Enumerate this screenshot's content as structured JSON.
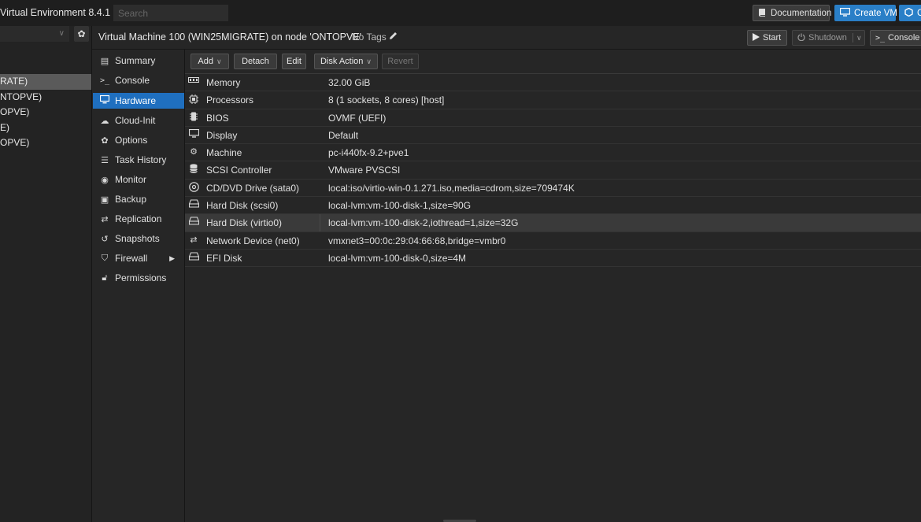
{
  "topbar": {
    "title": "Virtual Environment 8.4.1",
    "search_placeholder": "Search",
    "doc_label": "Documentation",
    "create_vm_label": "Create VM",
    "create_ct_label": "C"
  },
  "tree": {
    "items": [
      {
        "label": "RATE)",
        "selected": true
      },
      {
        "label": "NTOPVE)",
        "selected": false
      },
      {
        "label": "OPVE)",
        "selected": false
      },
      {
        "label": "E)",
        "selected": false
      },
      {
        "label": "OPVE)",
        "selected": false
      }
    ]
  },
  "header": {
    "title": "Virtual Machine 100 (WIN25MIGRATE) on node 'ONTOPVE'",
    "tags": "No Tags",
    "start_label": "Start",
    "shutdown_label": "Shutdown",
    "console_label": "Console"
  },
  "nav": {
    "items": [
      {
        "label": "Summary",
        "icon": "book-icon"
      },
      {
        "label": "Console",
        "icon": "terminal-icon"
      },
      {
        "label": "Hardware",
        "icon": "monitor-icon",
        "active": true
      },
      {
        "label": "Cloud-Init",
        "icon": "cloud-icon"
      },
      {
        "label": "Options",
        "icon": "gear-icon"
      },
      {
        "label": "Task History",
        "icon": "list-icon"
      },
      {
        "label": "Monitor",
        "icon": "eye-icon"
      },
      {
        "label": "Backup",
        "icon": "floppy-icon"
      },
      {
        "label": "Replication",
        "icon": "retweet-icon"
      },
      {
        "label": "Snapshots",
        "icon": "history-icon"
      },
      {
        "label": "Firewall",
        "icon": "shield-icon"
      },
      {
        "label": "Permissions",
        "icon": "unlock-icon"
      }
    ]
  },
  "toolbar": {
    "add_label": "Add",
    "detach_label": "Detach",
    "edit_label": "Edit",
    "disk_action_label": "Disk Action",
    "revert_label": "Revert"
  },
  "hardware": {
    "rows": [
      {
        "key": "Memory",
        "value": "32.00 GiB",
        "icon": "memory-icon"
      },
      {
        "key": "Processors",
        "value": "8 (1 sockets, 8 cores) [host]",
        "icon": "cpu-icon"
      },
      {
        "key": "BIOS",
        "value": "OVMF (UEFI)",
        "icon": "microchip-icon"
      },
      {
        "key": "Display",
        "value": "Default",
        "icon": "desktop-icon"
      },
      {
        "key": "Machine",
        "value": "pc-i440fx-9.2+pve1",
        "icon": "cogs-icon"
      },
      {
        "key": "SCSI Controller",
        "value": "VMware PVSCSI",
        "icon": "database-icon"
      },
      {
        "key": "CD/DVD Drive (sata0)",
        "value": "local:iso/virtio-win-0.1.271.iso,media=cdrom,size=709474K",
        "icon": "cdrom-icon"
      },
      {
        "key": "Hard Disk (scsi0)",
        "value": "local-lvm:vm-100-disk-1,size=90G",
        "icon": "hdd-icon"
      },
      {
        "key": "Hard Disk (virtio0)",
        "value": "local-lvm:vm-100-disk-2,iothread=1,size=32G",
        "icon": "hdd-icon",
        "selected": true
      },
      {
        "key": "Network Device (net0)",
        "value": "vmxnet3=00:0c:29:04:66:68,bridge=vmbr0",
        "icon": "exchange-icon"
      },
      {
        "key": "EFI Disk",
        "value": "local-lvm:vm-100-disk-0,size=4M",
        "icon": "hdd-icon"
      }
    ]
  }
}
